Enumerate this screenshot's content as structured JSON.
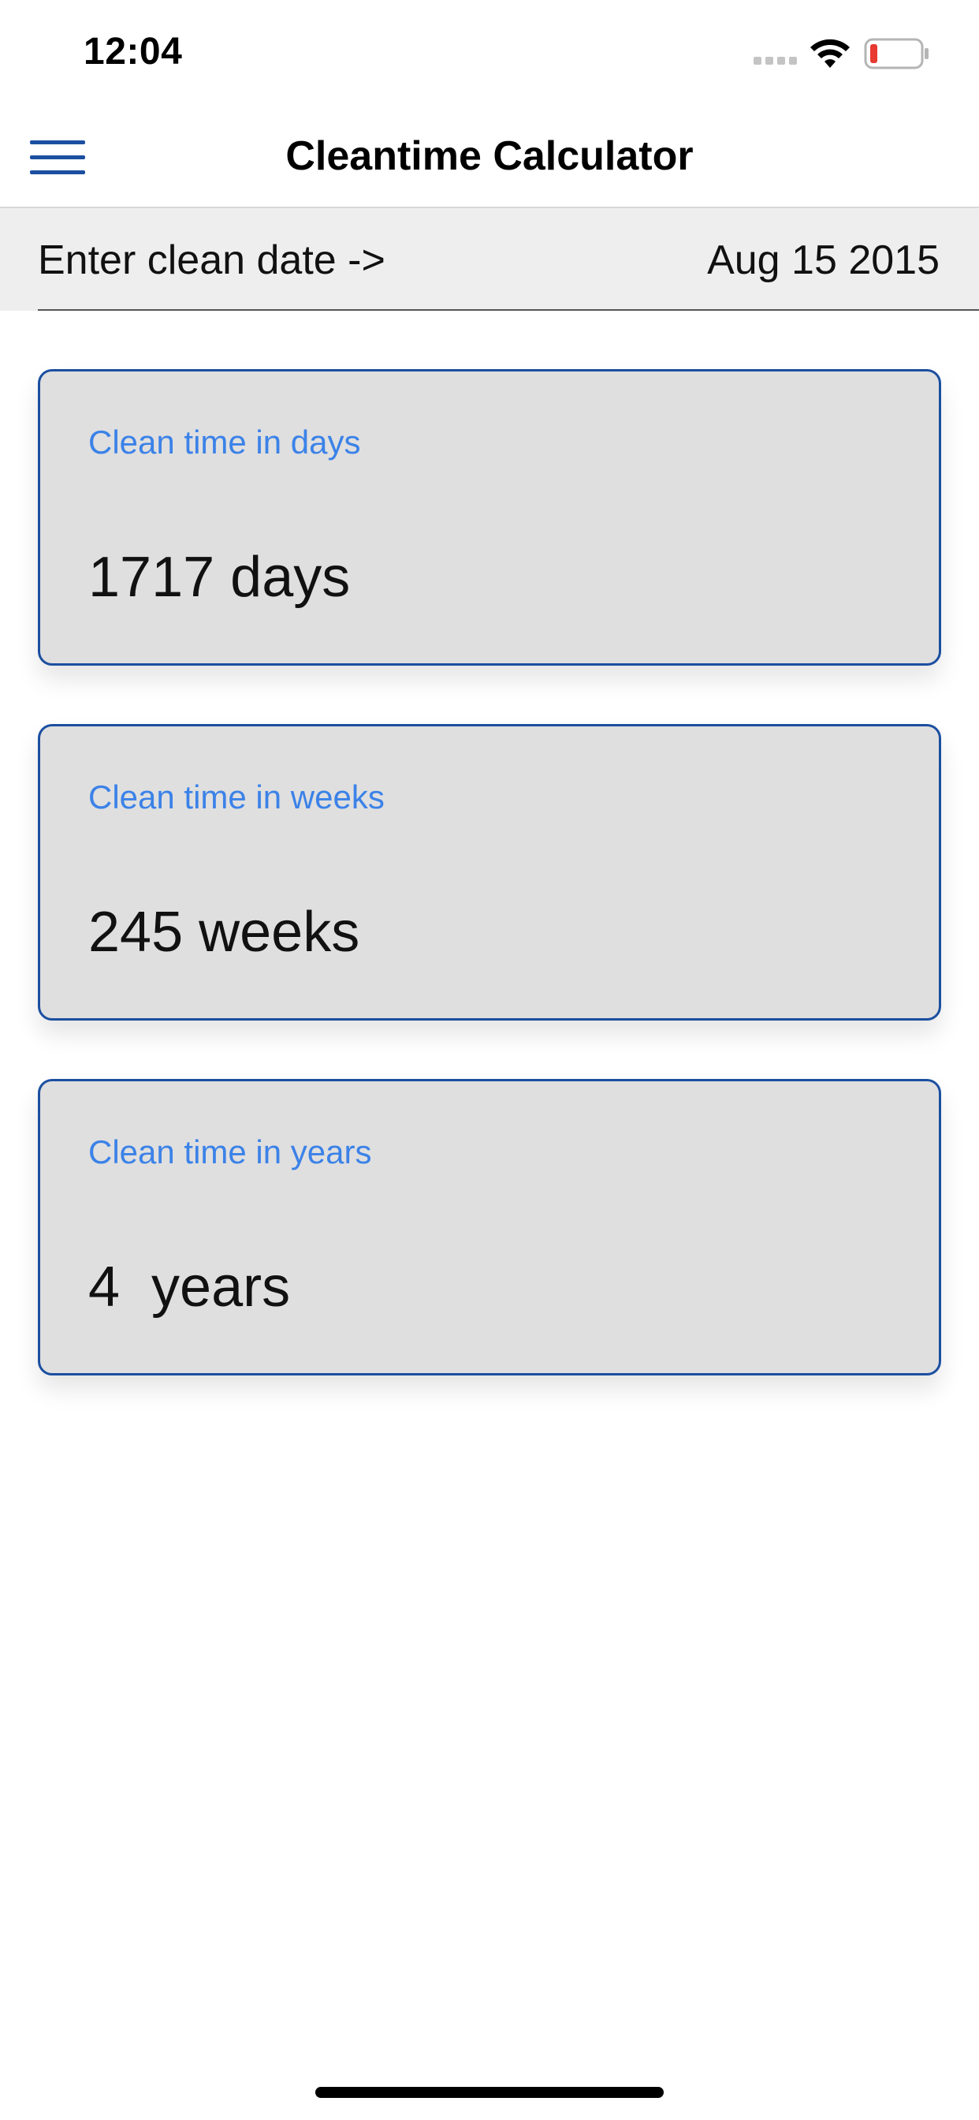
{
  "status_bar": {
    "time": "12:04",
    "icons": [
      "signal-icon",
      "wifi-icon",
      "battery-icon"
    ],
    "battery_color": "#e83a30"
  },
  "nav": {
    "title": "Cleantime Calculator",
    "menu_icon": "hamburger-menu-icon"
  },
  "date_row": {
    "label": "Enter clean date ->",
    "value": "Aug 15 2015"
  },
  "cards": [
    {
      "label": "Clean time in days",
      "value": "1717 days"
    },
    {
      "label": "Clean time in weeks",
      "value": "245 weeks"
    },
    {
      "label": "Clean time in years",
      "value": "4  years"
    }
  ],
  "colors": {
    "accent": "#1b4fa0",
    "label_blue": "#3b82e8",
    "card_bg": "#dfdfdf",
    "date_row_bg": "#eeeeee"
  }
}
